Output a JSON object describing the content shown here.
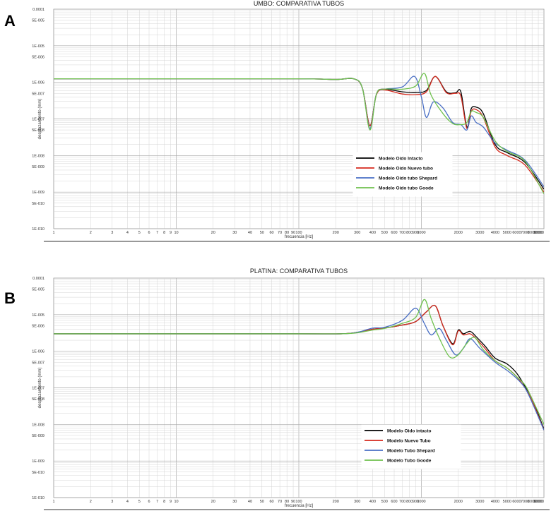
{
  "panels": [
    {
      "label": "A"
    },
    {
      "label": "B"
    }
  ],
  "chart_data": [
    {
      "type": "line",
      "title": "UMBO: COMPARATIVA TUBOS",
      "xlabel": "frecuencia [Hz]",
      "ylabel": "desplazamiento (mm)",
      "xscale": "log",
      "yscale": "log",
      "xlim": [
        1,
        10000
      ],
      "ylim": [
        1e-10,
        0.0001
      ],
      "x_tick_labels": [
        "1",
        "2",
        "3",
        "4",
        "5",
        "6",
        "7",
        "8",
        "9",
        "10",
        "20",
        "30",
        "40",
        "50",
        "60",
        "70",
        "80",
        "90",
        "100",
        "200",
        "300",
        "400",
        "500",
        "600",
        "700",
        "800",
        "900",
        "1000",
        "2000",
        "3000",
        "4000",
        "5000",
        "6000",
        "7000",
        "8000",
        "9000",
        "10000"
      ],
      "y_tick_labels": [
        "0.0001",
        "5E-005",
        "1E-005",
        "5E-006",
        "1E-006",
        "5E-007",
        "1E-007",
        "5E-008",
        "1E-008",
        "5E-009",
        "1E-009",
        "5E-010",
        "1E-010"
      ],
      "grid": true,
      "legend_position": "lower-right",
      "series": [
        {
          "name": "Modelo Oido Intacto",
          "color": "#000000",
          "x": [
            1,
            10,
            100,
            200,
            280,
            330,
            380,
            430,
            500,
            700,
            900,
            1100,
            1300,
            1600,
            1900,
            2100,
            2350,
            2550,
            2800,
            3200,
            4000,
            5000,
            7000,
            10000
          ],
          "y": [
            1.25e-06,
            1.25e-06,
            1.25e-06,
            1.2e-06,
            1.25e-06,
            7e-07,
            6.5e-08,
            4.8e-07,
            6.5e-07,
            5.5e-07,
            5.3e-07,
            6e-07,
            1.45e-06,
            5.5e-07,
            5.2e-07,
            5.5e-07,
            6e-08,
            1.9e-07,
            2.1e-07,
            1.4e-07,
            2e-08,
            1.2e-08,
            6.5e-09,
            1.2e-09
          ]
        },
        {
          "name": "Modelo Oido Nuevo tubo",
          "color": "#d42a1e",
          "x": [
            1,
            10,
            100,
            200,
            280,
            330,
            380,
            430,
            500,
            700,
            900,
            1100,
            1300,
            1600,
            1900,
            2100,
            2350,
            2550,
            2800,
            3200,
            4000,
            5000,
            7000,
            10000
          ],
          "y": [
            1.25e-06,
            1.25e-06,
            1.25e-06,
            1.2e-06,
            1.25e-06,
            7e-07,
            6.5e-08,
            4.6e-07,
            6.2e-07,
            4.8e-07,
            4.6e-07,
            5.5e-07,
            1.45e-06,
            5.2e-07,
            5e-07,
            4.2e-07,
            5.5e-08,
            1.6e-07,
            1.8e-07,
            1.1e-07,
            1.7e-08,
            1e-08,
            5.5e-09,
            1e-09
          ]
        },
        {
          "name": "Modelo Oido tubo Shepard",
          "color": "#4a6fc4",
          "x": [
            1,
            10,
            100,
            200,
            280,
            330,
            380,
            430,
            500,
            700,
            880,
            1000,
            1100,
            1250,
            1500,
            1800,
            2100,
            2350,
            2550,
            2800,
            3200,
            4000,
            5000,
            7000,
            10000
          ],
          "y": [
            1.25e-06,
            1.25e-06,
            1.25e-06,
            1.2e-06,
            1.25e-06,
            7e-07,
            5.5e-08,
            4.8e-07,
            6.5e-07,
            7.5e-07,
            1.45e-06,
            4e-07,
            1.1e-07,
            2.9e-07,
            2e-07,
            8e-08,
            7e-08,
            5e-08,
            1.2e-07,
            8e-08,
            6e-08,
            2.2e-08,
            1.4e-08,
            7.5e-09,
            1.4e-09
          ]
        },
        {
          "name": "Modelo Oido tubo Goode",
          "color": "#6fc14e",
          "x": [
            1,
            10,
            100,
            200,
            280,
            330,
            380,
            430,
            500,
            700,
            900,
            1060,
            1200,
            1500,
            1800,
            2100,
            2350,
            2550,
            2800,
            3200,
            4000,
            5000,
            7000,
            10000
          ],
          "y": [
            1.25e-06,
            1.25e-06,
            1.25e-06,
            1.2e-06,
            1.25e-06,
            7e-07,
            5e-08,
            4.8e-07,
            6.5e-07,
            6.5e-07,
            8e-07,
            1.75e-06,
            4.5e-07,
            1.4e-07,
            7.5e-08,
            7e-08,
            8e-08,
            1.6e-07,
            1.5e-07,
            1.1e-07,
            2.5e-08,
            1.3e-08,
            7e-09,
            9e-10
          ]
        }
      ]
    },
    {
      "type": "line",
      "title": "PLATINA: COMPARATIVA TUBOS",
      "xlabel": "frecuencia [Hz]",
      "ylabel": "desplazamiento (mm)",
      "xscale": "log",
      "yscale": "log",
      "xlim": [
        1,
        10000
      ],
      "ylim": [
        1e-10,
        0.0001
      ],
      "x_tick_labels": [
        "1",
        "2",
        "3",
        "4",
        "5",
        "6",
        "7",
        "8",
        "9",
        "10",
        "20",
        "30",
        "40",
        "50",
        "60",
        "70",
        "80",
        "90",
        "100",
        "200",
        "300",
        "400",
        "500",
        "600",
        "700",
        "800",
        "900",
        "1000",
        "2000",
        "3000",
        "4000",
        "5000",
        "6000",
        "7000",
        "8000",
        "9000",
        "10000"
      ],
      "y_tick_labels": [
        "0.0001",
        "5E-005",
        "1E-005",
        "5E-006",
        "1E-006",
        "5E-007",
        "1E-007",
        "5E-008",
        "1E-008",
        "5E-009",
        "1E-009",
        "5E-010",
        "1E-010"
      ],
      "grid": true,
      "legend_position": "lower-right",
      "series": [
        {
          "name": "Modelo Oido intacto",
          "color": "#000000",
          "x": [
            1,
            10,
            100,
            220,
            300,
            400,
            500,
            700,
            900,
            1100,
            1300,
            1500,
            1800,
            2000,
            2200,
            2500,
            2800,
            3300,
            4000,
            5000,
            6000,
            7000,
            8000,
            10000
          ],
          "y": [
            3e-06,
            3e-06,
            3e-06,
            3e-06,
            3.3e-06,
            4e-06,
            4.3e-06,
            5.2e-06,
            6.5e-06,
            1.2e-05,
            1.75e-05,
            5e-06,
            1.6e-06,
            3.8e-06,
            3e-06,
            3.5e-06,
            2.5e-06,
            1.4e-06,
            6.5e-07,
            4.5e-07,
            2.5e-07,
            1.1e-07,
            5e-08,
            7.5e-09
          ]
        },
        {
          "name": "Modelo Nuevo Tubo",
          "color": "#d42a1e",
          "x": [
            1,
            10,
            100,
            220,
            300,
            400,
            500,
            700,
            900,
            1100,
            1300,
            1500,
            1800,
            2000,
            2200,
            2500,
            2800,
            3300,
            4000,
            5000,
            6000,
            7000,
            8000,
            10000
          ],
          "y": [
            3e-06,
            3e-06,
            3e-06,
            3e-06,
            3.3e-06,
            4e-06,
            4.3e-06,
            5.2e-06,
            6.5e-06,
            1.2e-05,
            1.75e-05,
            5e-06,
            1.5e-06,
            3.6e-06,
            2.8e-06,
            3e-06,
            2.2e-06,
            1.2e-06,
            5.5e-07,
            3.5e-07,
            2e-07,
            1e-07,
            4.5e-08,
            7e-09
          ]
        },
        {
          "name": "Modelo Tubo Shepard",
          "color": "#4a6fc4",
          "x": [
            1,
            10,
            100,
            220,
            300,
            400,
            500,
            700,
            900,
            1050,
            1200,
            1400,
            1600,
            1900,
            2200,
            2500,
            3000,
            4000,
            5000,
            6000,
            7000,
            8000,
            10000
          ],
          "y": [
            3e-06,
            3e-06,
            3e-06,
            3e-06,
            3.3e-06,
            4.3e-06,
            4.5e-06,
            7e-06,
            1.5e-05,
            6e-06,
            2.8e-06,
            4.2e-06,
            2e-06,
            8e-07,
            1.2e-06,
            2.2e-06,
            1.2e-06,
            5e-07,
            3e-07,
            1.8e-07,
            1e-07,
            4e-08,
            7e-09
          ]
        },
        {
          "name": "Modelo Tubo Goode",
          "color": "#6fc14e",
          "x": [
            1,
            10,
            100,
            220,
            300,
            400,
            500,
            700,
            900,
            1060,
            1200,
            1400,
            1700,
            2000,
            2300,
            2700,
            3200,
            4000,
            5000,
            6000,
            7000,
            8000,
            10000
          ],
          "y": [
            3e-06,
            3e-06,
            3e-06,
            3e-06,
            3.2e-06,
            3.8e-06,
            4.2e-06,
            5.8e-06,
            8.5e-06,
            2.6e-05,
            8e-06,
            2.3e-06,
            7e-07,
            8e-07,
            1.5e-06,
            2.4e-06,
            1.1e-06,
            5.5e-07,
            3.5e-07,
            2e-07,
            1.2e-07,
            5e-08,
            1e-08
          ]
        }
      ]
    }
  ]
}
